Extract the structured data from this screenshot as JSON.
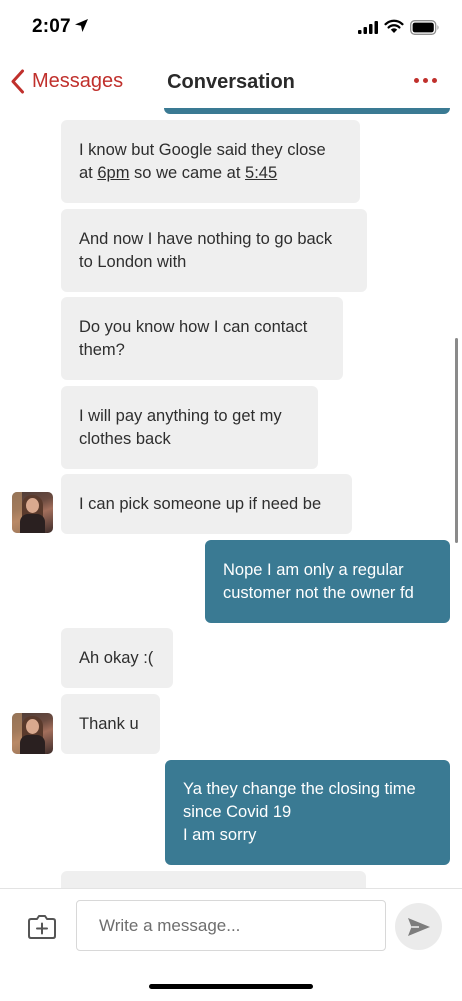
{
  "status_bar": {
    "time": "2:07"
  },
  "nav": {
    "back_label": "Messages",
    "title": "Conversation"
  },
  "messages": [
    {
      "from": "them",
      "parts": [
        {
          "text": "I know but Google said they close at ",
          "u": false
        },
        {
          "text": "6pm",
          "u": true
        },
        {
          "text": " so we came at ",
          "u": false
        },
        {
          "text": "5:45",
          "u": true
        }
      ]
    },
    {
      "from": "them",
      "text": "And now I have nothing to go back to London with"
    },
    {
      "from": "them",
      "text": "Do you know how I can contact them?"
    },
    {
      "from": "them",
      "text": "I will pay anything to get my clothes back"
    },
    {
      "from": "them",
      "text": "I can pick someone up if need be",
      "avatar": true
    },
    {
      "from": "me",
      "text": "Nope I am only a regular customer not the owner fd"
    },
    {
      "from": "them",
      "text": "Ah okay :("
    },
    {
      "from": "them",
      "text": "Thank u",
      "avatar": true
    },
    {
      "from": "me",
      "lines": [
        "Ya they change the closing time since Covid 19",
        "I am sorry"
      ]
    }
  ],
  "composer": {
    "placeholder": "Write a message..."
  },
  "colors": {
    "accent": "#c0302c",
    "sent_bubble": "#3a7a93",
    "received_bubble": "#efefef"
  },
  "icons": {
    "back": "chevron-left-icon",
    "more": "more-dots-icon",
    "attach": "attachment-plus-icon",
    "send": "send-icon"
  }
}
